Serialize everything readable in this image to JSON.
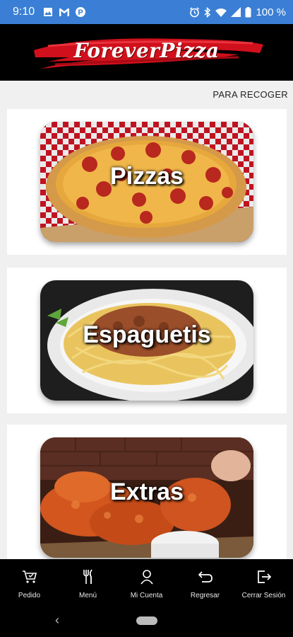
{
  "status_bar": {
    "time": "9:10",
    "left_icons": [
      "image-icon",
      "gmail-icon",
      "parking-icon"
    ],
    "right_icons": [
      "alarm-icon",
      "bluetooth-icon",
      "wifi-icon",
      "signal-icon",
      "battery-icon"
    ],
    "battery": "100 %",
    "bg_color": "#3a7fd5"
  },
  "header": {
    "logo_text": "ForeverPizza",
    "bg_color": "#000000",
    "accent_color": "#d0101c"
  },
  "order_mode": {
    "label": "PARA RECOGER"
  },
  "menu": {
    "categories": [
      {
        "label": "Pizzas",
        "image": "pizza-photo"
      },
      {
        "label": "Espaguetis",
        "image": "spaghetti-photo"
      },
      {
        "label": "Extras",
        "image": "wings-photo"
      }
    ]
  },
  "bottom_nav": {
    "items": [
      {
        "label": "Pedido",
        "icon": "cart-icon"
      },
      {
        "label": "Menú",
        "icon": "fork-knife-icon"
      },
      {
        "label": "Mi Cuenta",
        "icon": "user-icon"
      },
      {
        "label": "Regresar",
        "icon": "return-icon"
      },
      {
        "label": "Cerrar Sesión",
        "icon": "logout-icon"
      }
    ]
  },
  "system_nav": {
    "icons": [
      "back-chevron-icon",
      "home-pill-icon"
    ]
  }
}
